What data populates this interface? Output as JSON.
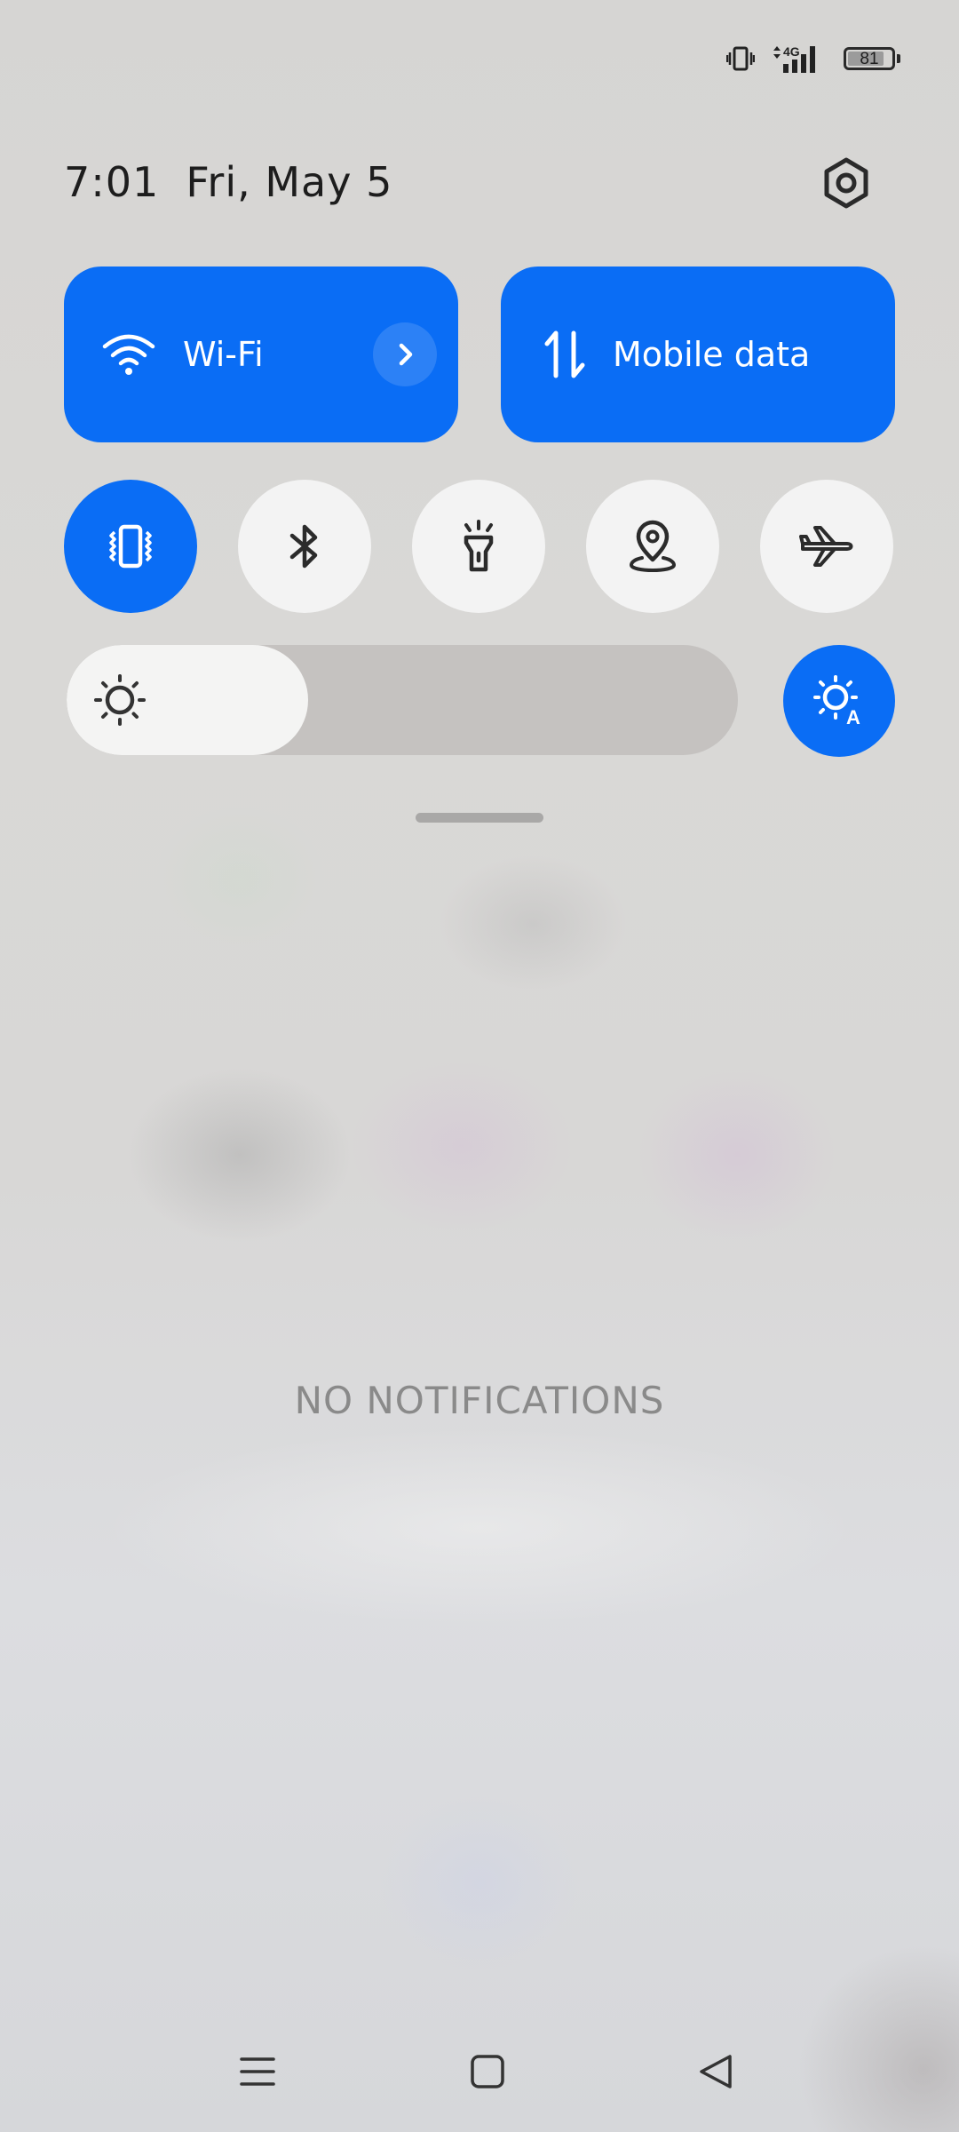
{
  "status_bar": {
    "icons": [
      "vibrate-icon",
      "4g-signal-icon",
      "battery-icon"
    ],
    "network": "4G",
    "battery_level": "81"
  },
  "header": {
    "time": "7:01",
    "date": "Fri, May 5",
    "settings_icon": "settings-hex-icon"
  },
  "tiles": {
    "wifi": {
      "label": "Wi-Fi",
      "active": true,
      "icon": "wifi-icon",
      "more_icon": "chevron-right-icon"
    },
    "mobile_data": {
      "label": "Mobile data",
      "active": true,
      "icon": "data-arrows-icon"
    }
  },
  "toggles": [
    {
      "name": "vibrate",
      "icon": "vibrate-icon",
      "active": true
    },
    {
      "name": "bluetooth",
      "icon": "bluetooth-icon",
      "active": false
    },
    {
      "name": "flashlight",
      "icon": "flashlight-icon",
      "active": false
    },
    {
      "name": "location",
      "icon": "location-icon",
      "active": false
    },
    {
      "name": "airplane-mode",
      "icon": "airplane-icon",
      "active": false
    }
  ],
  "brightness": {
    "level_fraction": 0.36,
    "icon": "brightness-sun-icon",
    "auto_icon": "auto-brightness-icon",
    "auto_enabled": true
  },
  "notifications": {
    "empty_text": "NO NOTIFICATIONS"
  },
  "nav_bar": {
    "menu_icon": "menu-icon",
    "home_icon": "home-icon",
    "back_icon": "back-icon"
  },
  "colors": {
    "accent": "#0a6df5",
    "toggle_off": "#f3f3f3",
    "text_dark": "#1d1d1d",
    "text_muted": "#8a8a8a"
  }
}
